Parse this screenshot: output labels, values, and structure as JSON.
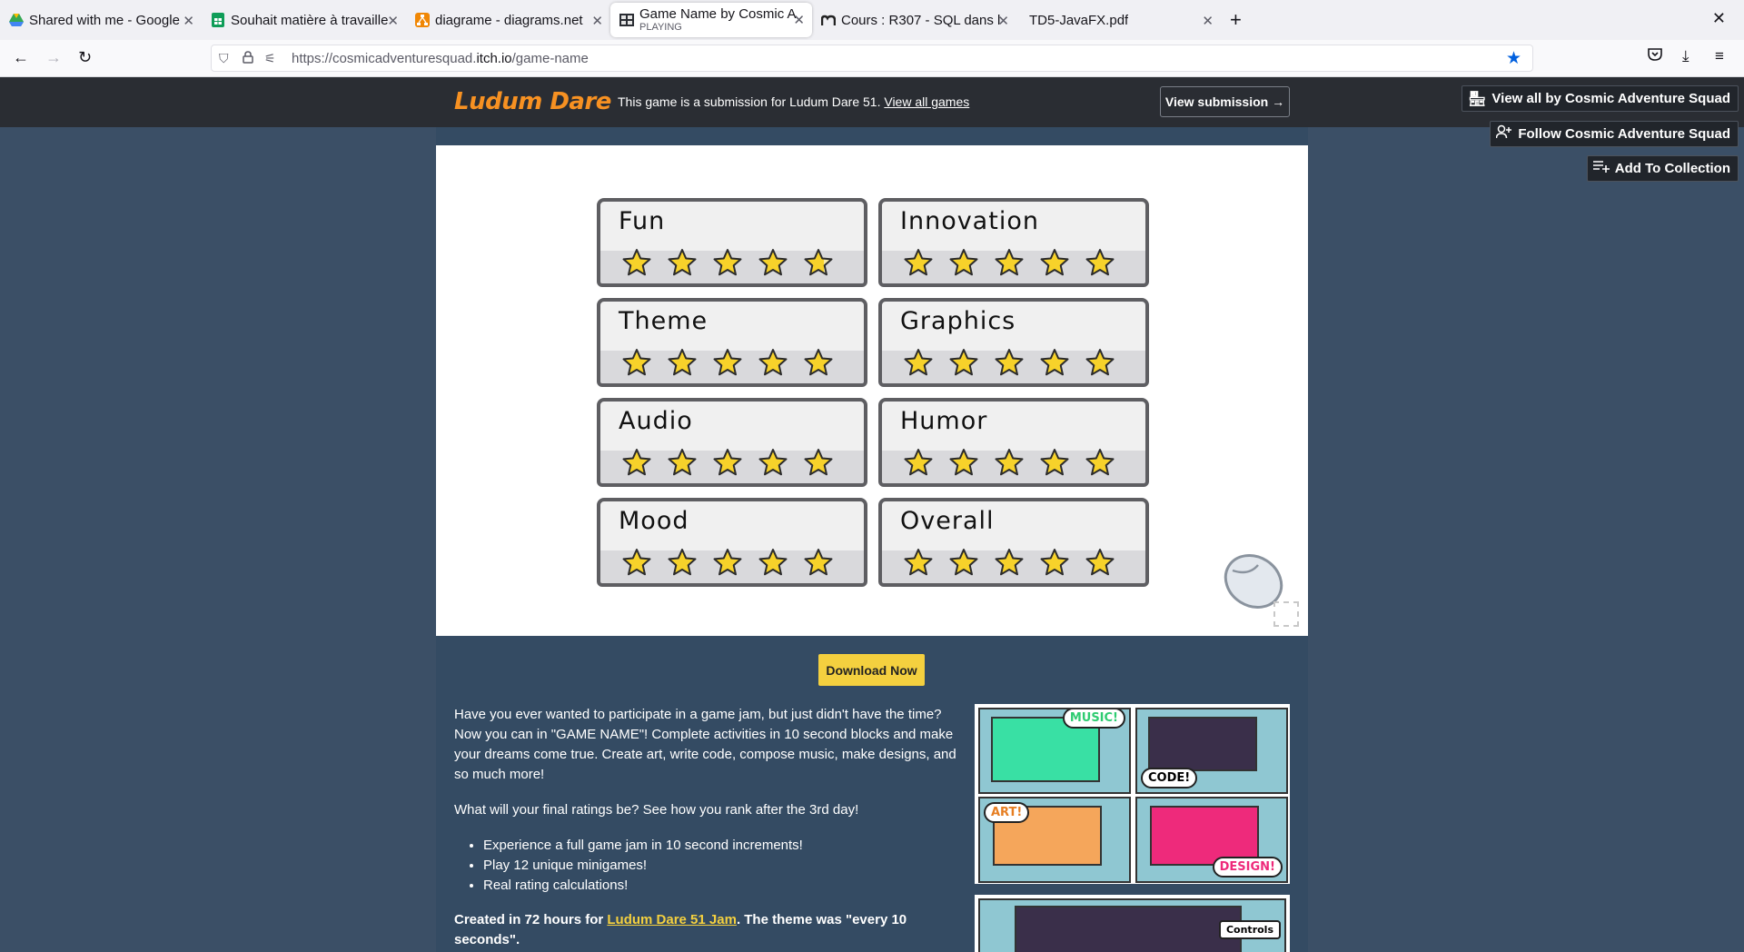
{
  "browser": {
    "tabs": [
      {
        "title": "Shared with me - Google",
        "icon": "google-drive-icon"
      },
      {
        "title": "Souhait matière à travaille",
        "icon": "google-sheets-icon"
      },
      {
        "title": "diagrame - diagrams.net",
        "icon": "diagrams-net-icon"
      },
      {
        "title": "Game Name by Cosmic A",
        "subtitle": "PLAYING",
        "icon": "itch-game-icon",
        "active": true
      },
      {
        "title": "Cours : R307 - SQL dans l",
        "icon": "moodle-icon"
      },
      {
        "title": "TD5-JavaFX.pdf",
        "icon": ""
      }
    ],
    "url_prefix": "https://cosmicadventuresquad.",
    "url_domain": "itch.io",
    "url_path": "/game-name"
  },
  "ld_banner": {
    "logo": "Ludum Dare",
    "text": "This game is a submission for Ludum Dare 51.",
    "link": "View all games",
    "button": "View submission →"
  },
  "side_buttons": {
    "view_all": "View all by Cosmic Adventure Squad",
    "follow": "Follow Cosmic Adventure Squad",
    "add_collection": "Add To Collection"
  },
  "ratings": [
    {
      "label": "Fun",
      "stars": 4.7
    },
    {
      "label": "Innovation",
      "stars": 5
    },
    {
      "label": "Theme",
      "stars": 5
    },
    {
      "label": "Graphics",
      "stars": 5
    },
    {
      "label": "Audio",
      "stars": 5
    },
    {
      "label": "Humor",
      "stars": 5
    },
    {
      "label": "Mood",
      "stars": 5
    },
    {
      "label": "Overall",
      "stars": 5
    }
  ],
  "download": "Download Now",
  "description": {
    "p1": "Have you ever wanted to participate in a game jam, but just didn't have the time? Now you can in \"GAME NAME\"! Complete activities in 10 second blocks and make your dreams come true. Create art, write code, compose music, make designs, and so much more!",
    "p2": "What will your final ratings be? See how you rank after the 3rd day!",
    "bullets": [
      "Experience a full game jam in 10 second increments!",
      "Play 12 unique minigames!",
      "Real rating calculations!"
    ],
    "created_prefix": "Created in 72 hours for ",
    "created_link": "Ludum Dare 51 Jam",
    "created_suffix": ". The theme was \"every 10 seconds\"."
  },
  "screenshot_labels": {
    "music": "MUSIC!",
    "code": "CODE!",
    "art": "ART!",
    "design": "DESIGN!",
    "controls": "Controls"
  },
  "colors": {
    "page_bg": "#3b4f66",
    "accent_yellow": "#f4d03f",
    "ld_orange": "#f79122",
    "bookmark_blue": "#0060df"
  }
}
